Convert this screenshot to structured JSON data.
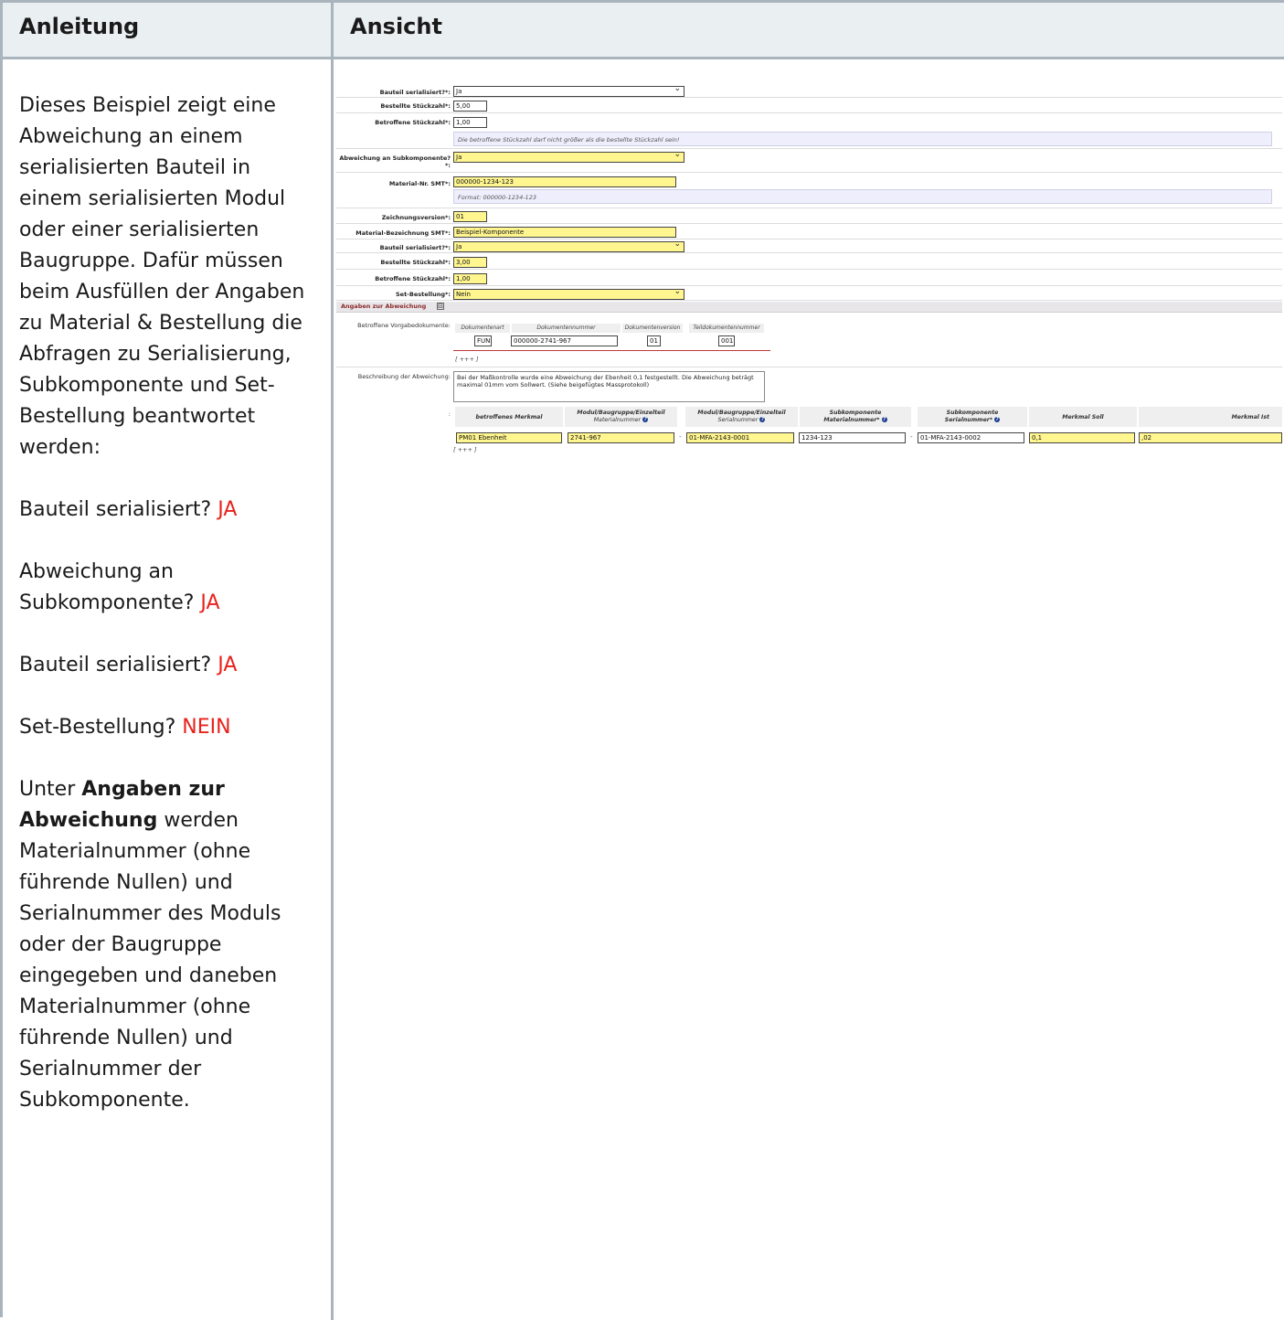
{
  "header": {
    "left": "Anleitung",
    "right": "Ansicht"
  },
  "instructions": {
    "intro": "Dieses Beispiel zeigt eine Abweichung an einem serialisierten Bauteil in einem serialisierten Modul oder einer serialisierten Baugruppe. Dafür müssen beim Ausfüllen der Angaben zu Material & Bestellung die Abfragen zu Serialisierung, Subkomponente und Set-Bestellung beantwortet werden:",
    "q1": "Bauteil serialisiert?",
    "a1": "JA",
    "q2": "Abweichung an Subkomponente?",
    "a2": "JA",
    "q3": "Bauteil serialisiert?",
    "a3": "JA",
    "q4": "Set-Bestellung?",
    "a4": "NEIN",
    "outro_pre": "Unter",
    "outro_bold": "Angaben zur Abweichung",
    "outro_post": "werden Materialnummer (ohne führende Nullen) und Serialnummer des Moduls oder der Baugruppe eingegeben und daneben Materialnummer (ohne führende Nullen) und Serialnummer der Subkomponente."
  },
  "form": {
    "bauteil_serialisiert_1": {
      "label": "Bauteil serialisiert?*:",
      "value": "Ja"
    },
    "bestellte_stueckzahl_1": {
      "label": "Bestellte Stückzahl*:",
      "value": "5,00"
    },
    "betroffene_stueckzahl_1": {
      "label": "Betroffene Stückzahl*:",
      "value": "1,00"
    },
    "hint_stueckzahl": "Die betroffene Stückzahl darf nicht größer als die bestellte Stückzahl sein!",
    "abweichung_subkomponente": {
      "label": "Abweichung an Subkomponente?",
      "label2": "*:",
      "value": "Ja"
    },
    "material_nr": {
      "label": "Material-Nr. SMT*:",
      "value": "000000-1234-123"
    },
    "hint_format": "Format: 000000-1234-123",
    "zeichnungsversion": {
      "label": "Zeichnungsversion*:",
      "value": "01"
    },
    "material_bezeichnung": {
      "label": "Material-Bezeichnung SMT*:",
      "value": "Beispiel-Komponente"
    },
    "bauteil_serialisiert_2": {
      "label": "Bauteil serialisiert?*:",
      "value": "Ja"
    },
    "bestellte_stueckzahl_2": {
      "label": "Bestellte Stückzahl*:",
      "value": "3,00"
    },
    "betroffene_stueckzahl_2": {
      "label": "Betroffene Stückzahl*:",
      "value": "1,00"
    },
    "set_bestellung": {
      "label": "Set-Bestellung*:",
      "value": "Nein"
    },
    "section_title": "Angaben zur Abweichung",
    "section_toggle": "⊟",
    "vorgabe_label": "Betroffene Vorgabedokumente:",
    "vorgabe_headers": [
      "Dokumentenart",
      "Dokumentennummer",
      "Dokumentenversion",
      "Teildokumentennummer"
    ],
    "vorgabe_values": [
      "FUN",
      "000000-2741-967",
      "01",
      "001"
    ],
    "add_more": "[ +++ ]",
    "beschreibung_label": "Beschreibung der Abweichung:",
    "beschreibung_value": "Bei der Maßkontrolle wurde eine Abweichung der Ebenheit 0,1 festgestellt. Die Abweichung beträgt maximal 01mm vom Sollwert. (Siehe beigefügtes Massprotokoll)",
    "grid_colon": ":",
    "grid_headers": [
      {
        "title": "betroffenes Merkmal",
        "sub": ""
      },
      {
        "title": "Modul/Baugruppe/Einzelteil",
        "sub": "Materialnummer"
      },
      {
        "title": "Modul/Baugruppe/Einzelteil",
        "sub": "Serialnummer"
      },
      {
        "title": "Subkomponente",
        "sub": "Materialnummer*"
      },
      {
        "title": "Subkomponente",
        "sub": "Serialnummer*"
      },
      {
        "title": "Merkmal Soll",
        "sub": ""
      },
      {
        "title": "Merkmal Ist",
        "sub": ""
      }
    ],
    "qm_icon": "?",
    "grid_values": [
      "PM01 Ebenheit",
      "2741-967",
      "01-MFA-2143-0001",
      "1234-123",
      "01-MFA-2143-0002",
      "0,1",
      ",02"
    ],
    "dash": "-"
  },
  "colors": {
    "required_field": "#fff68f",
    "answer_red": "#e8221c",
    "hint_bg": "#eeeefc"
  }
}
